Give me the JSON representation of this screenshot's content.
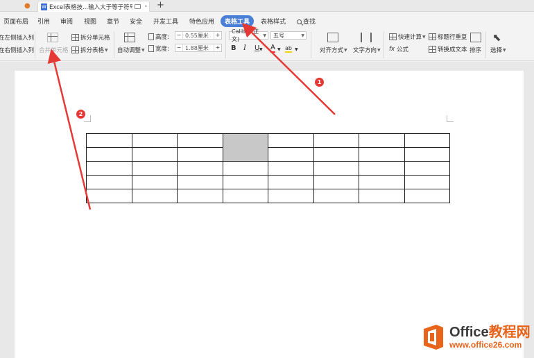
{
  "tabbar": {
    "doc_icon_letter": "W",
    "doc_title": "Excel表格技...输入大于等于符号",
    "close_glyph": "•",
    "new_tab_glyph": "+"
  },
  "menu": {
    "items": [
      "页面布局",
      "引用",
      "审阅",
      "视图",
      "章节",
      "安全",
      "开发工具",
      "特色应用",
      "表格工具",
      "表格样式",
      "查找"
    ],
    "active": "表格工具"
  },
  "ribbon": {
    "insert_left": "在左侧插入列",
    "insert_right": "在右侧插入列",
    "merge_cells": "合并单元格",
    "split_cells": "拆分单元格",
    "split_table": "拆分表格",
    "auto_adjust": "自动调整",
    "height_label": "高度:",
    "height_value": "0.55厘米",
    "width_label": "宽度:",
    "width_value": "1.88厘米",
    "minus": "−",
    "plus": "+",
    "font_name": "Calibri (正文)",
    "font_size": "五号",
    "bold": "B",
    "italic": "I",
    "underline": "U",
    "font_color": "A",
    "highlight": "ab",
    "align": "对齐方式",
    "text_direction": "文字方向",
    "quick_calc": "快速计算",
    "formula": "公式",
    "repeat_header": "标题行重复",
    "to_text": "转换成文本",
    "sort": "排序",
    "select": "选择"
  },
  "table": {
    "rows": 5,
    "cols": 8,
    "shaded_cell": "row 1-2, col 4"
  },
  "annotations": {
    "marker1": "1",
    "marker2": "2",
    "color": "#e53935"
  },
  "watermark": {
    "name_main": "Office",
    "name_sub": "教程网",
    "url": "www.office26.com"
  },
  "colors": {
    "accent": "#4a7fd8",
    "watermark_orange": "#e8641b"
  }
}
